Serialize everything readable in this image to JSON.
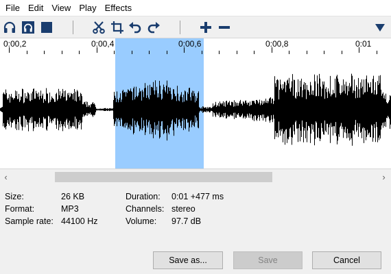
{
  "menu": [
    "File",
    "Edit",
    "View",
    "Play",
    "Effects"
  ],
  "toolbar": {
    "icons": [
      "headphones-icon",
      "headphones-selection-icon",
      "stop-icon",
      "cut-icon",
      "crop-icon",
      "undo-icon",
      "redo-icon",
      "zoom-in-icon",
      "zoom-out-icon",
      "dropdown-triangle-icon"
    ]
  },
  "ruler": {
    "labels": [
      "0:00,2",
      "0:00,4",
      "0:00,6",
      "0:00,8",
      "0:01"
    ]
  },
  "selection": {
    "start_seconds": 0.42,
    "end_seconds": 0.62
  },
  "info": {
    "size_label": "Size:",
    "size_value": "26 KB",
    "format_label": "Format:",
    "format_value": "MP3",
    "rate_label": "Sample rate:",
    "rate_value": "44100 Hz",
    "duration_label": "Duration:",
    "duration_value": "0:01 +477 ms",
    "channels_label": "Channels:",
    "channels_value": "stereo",
    "volume_label": "Volume:",
    "volume_value": "97.7 dB"
  },
  "buttons": {
    "save_as": "Save as...",
    "save": "Save",
    "cancel": "Cancel"
  },
  "colors": {
    "selection": "#99ccff",
    "waveform": "#000000",
    "accent": "#1a5fb4"
  }
}
